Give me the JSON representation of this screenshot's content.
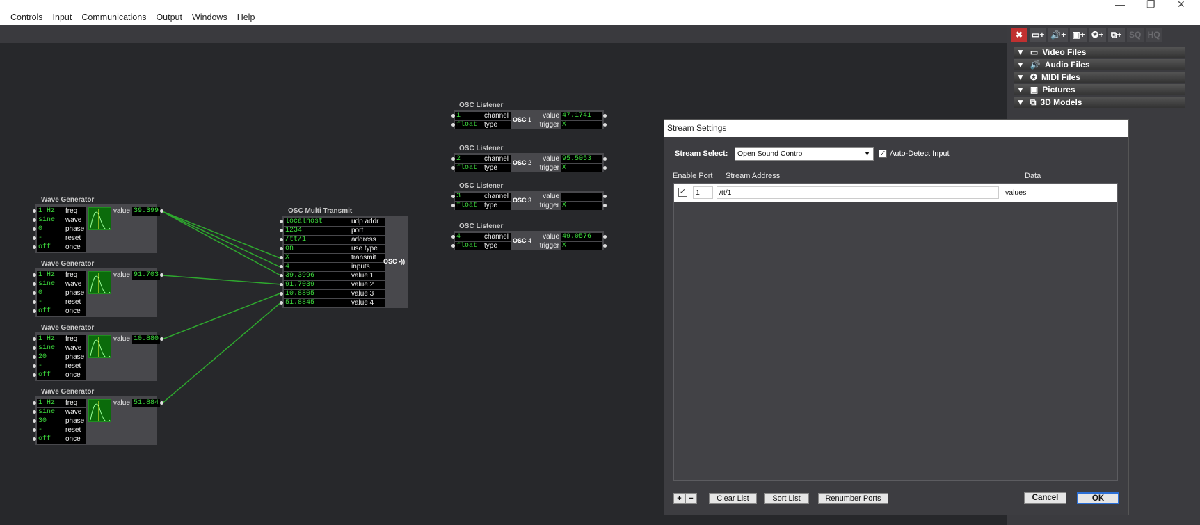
{
  "menu": [
    "Controls",
    "Input",
    "Communications",
    "Output",
    "Windows",
    "Help"
  ],
  "toolbar": {
    "buttons": [
      "✖",
      "▭+",
      "🔊+",
      "▣+",
      "✪+",
      "⧉+",
      "SQ",
      "HQ"
    ]
  },
  "media_bins": [
    {
      "label": "Video Files",
      "icon": "film-icon"
    },
    {
      "label": "Audio Files",
      "icon": "speaker-icon"
    },
    {
      "label": "MIDI Files",
      "icon": "midi-icon"
    },
    {
      "label": "Pictures",
      "icon": "picture-icon"
    },
    {
      "label": "3D Models",
      "icon": "cube-icon"
    }
  ],
  "wave_generators": [
    {
      "title": "Wave Generator",
      "freq": "1 Hz",
      "wave": "sine",
      "phase": "0",
      "reset": "-",
      "once": "off",
      "value": "39.399"
    },
    {
      "title": "Wave Generator",
      "freq": "1 Hz",
      "wave": "sine",
      "phase": "0",
      "reset": "-",
      "once": "off",
      "value": "91.703"
    },
    {
      "title": "Wave Generator",
      "freq": "1 Hz",
      "wave": "sine",
      "phase": "20",
      "reset": "-",
      "once": "off",
      "value": "10.880"
    },
    {
      "title": "Wave Generator",
      "freq": "1 Hz",
      "wave": "sine",
      "phase": "30",
      "reset": "-",
      "once": "off",
      "value": "51.884"
    }
  ],
  "wave_labels": [
    "freq",
    "wave",
    "phase",
    "reset",
    "once"
  ],
  "multi_transmit": {
    "title": "OSC Multi Transmit",
    "rows": [
      {
        "value": "localhost",
        "label": "udp addr"
      },
      {
        "value": "1234",
        "label": "port"
      },
      {
        "value": "/tt/1",
        "label": "address"
      },
      {
        "value": "on",
        "label": "use type"
      },
      {
        "value": "X",
        "label": "transmit"
      },
      {
        "value": "4",
        "label": "inputs"
      },
      {
        "value": "39.3996",
        "label": "value 1"
      },
      {
        "value": "91.7039",
        "label": "value 2"
      },
      {
        "value": "10.8805",
        "label": "value 3"
      },
      {
        "value": "51.8845",
        "label": "value 4"
      }
    ],
    "logo": "OSC •))"
  },
  "listeners": [
    {
      "title": "OSC Listener",
      "channel": "1",
      "type": "float",
      "num": "1",
      "value": "47.1741",
      "trigger": "X"
    },
    {
      "title": "OSC Listener",
      "channel": "2",
      "type": "float",
      "num": "2",
      "value": "95.5053",
      "trigger": "X"
    },
    {
      "title": "OSC Listener",
      "channel": "3",
      "type": "float",
      "num": "3",
      "value": "",
      "trigger": "X"
    },
    {
      "title": "OSC Listener",
      "channel": "4",
      "type": "float",
      "num": "4",
      "value": "49.0576",
      "trigger": "X"
    }
  ],
  "listener_labels": {
    "channel": "channel",
    "type": "type",
    "value": "value",
    "trigger": "trigger",
    "logo": "OSC"
  },
  "dialog": {
    "title": "Stream Settings",
    "stream_select_label": "Stream Select:",
    "stream_select_value": "Open Sound Control",
    "auto_detect_label": "Auto-Detect Input",
    "col_enable": "Enable Port",
    "col_address": "Stream Address",
    "col_data": "Data",
    "row": {
      "port": "1",
      "address": "/tt/1",
      "data": "values"
    },
    "add": "+",
    "remove": "−",
    "clear": "Clear List",
    "sort": "Sort List",
    "renumber": "Renumber Ports",
    "cancel": "Cancel",
    "ok": "OK"
  }
}
